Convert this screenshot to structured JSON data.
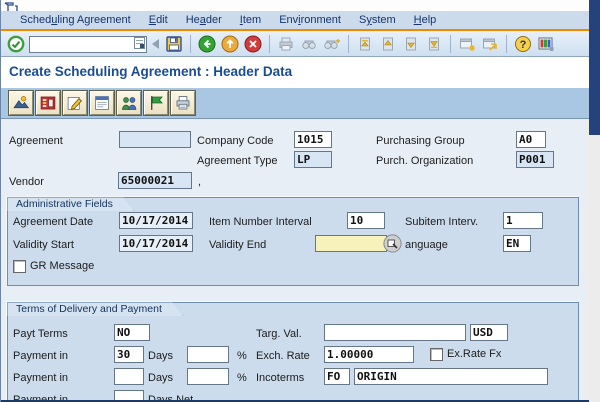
{
  "chrome": {
    "title": "Create Scheduling Agreement : Header Data",
    "menu": {
      "items": [
        {
          "pre": "Sched",
          "accel": "u",
          "post": "ling Agreement"
        },
        {
          "pre": "",
          "accel": "E",
          "post": "dit"
        },
        {
          "pre": "He",
          "accel": "a",
          "post": "der"
        },
        {
          "pre": "",
          "accel": "I",
          "post": "tem"
        },
        {
          "pre": "Env",
          "accel": "i",
          "post": "ronment"
        },
        {
          "pre": "S",
          "accel": "y",
          "post": "stem"
        },
        {
          "pre": "",
          "accel": "H",
          "post": "elp"
        }
      ]
    },
    "toolbar": {
      "command_value": "",
      "icons": [
        "enter",
        "command-field",
        "collapse",
        "save",
        "back",
        "exit",
        "cancel",
        "print",
        "find",
        "find-next",
        "first-page",
        "previous-page",
        "next-page",
        "last-page",
        "new-session",
        "create-shortcut",
        "help",
        "customize-layout"
      ]
    },
    "app_toolbar": {
      "buttons": [
        "overview",
        "item-detail",
        "change",
        "header-details",
        "partners",
        "set-flag",
        "print"
      ]
    }
  },
  "header_form": {
    "agreement": {
      "label": "Agreement",
      "value": ""
    },
    "company_code": {
      "label": "Company Code",
      "value": "1015"
    },
    "purchasing_group": {
      "label": "Purchasing Group",
      "value": "A0"
    },
    "agreement_type": {
      "label": "Agreement Type",
      "value": "LP"
    },
    "purch_organization": {
      "label": "Purch. Organization",
      "value": "P001"
    },
    "vendor": {
      "label": "Vendor",
      "value": "65000021",
      "suffix": ","
    }
  },
  "admin": {
    "section_title": "Administrative Fields",
    "agreement_date": {
      "label": "Agreement Date",
      "value": "10/17/2014"
    },
    "item_number_interval": {
      "label": "Item Number Interval",
      "value": "10"
    },
    "subitem_interval": {
      "label": "Subitem Interv.",
      "value": "1"
    },
    "validity_start": {
      "label": "Validity Start",
      "value": "10/17/2014"
    },
    "validity_end": {
      "label": "Validity End",
      "value": ""
    },
    "language": {
      "label": "anguage",
      "value": "EN"
    },
    "gr_message": {
      "label": "GR Message",
      "checked": false
    }
  },
  "terms": {
    "section_title": "Terms of Delivery and Payment",
    "payt_terms": {
      "label": "Payt Terms",
      "value": "NO"
    },
    "targ_val": {
      "label": "Targ. Val.",
      "value": "",
      "currency": "USD"
    },
    "exch_rate": {
      "label": "Exch. Rate",
      "value": "1.00000"
    },
    "ex_rate_fx": {
      "label": "Ex.Rate Fx",
      "checked": false
    },
    "incoterms": {
      "label": "Incoterms",
      "value1": "FO",
      "value2": "ORIGIN"
    },
    "payment_rows": [
      {
        "label": "Payment in",
        "days_value": "30",
        "days_label": "Days",
        "percent_value": "",
        "percent_label": "%"
      },
      {
        "label": "Payment in",
        "days_value": "",
        "days_label": "Days",
        "percent_value": "",
        "percent_label": "%"
      },
      {
        "label": "Payment in",
        "days_value": "",
        "days_label": "Days Net"
      }
    ]
  },
  "colors": {
    "accent_orange": "#ef8a00",
    "menubar_blue": "#ccdbeb",
    "app_toolbar_blue": "#a9c6e3",
    "content_blue": "#cddcec",
    "title_text": "#1a4c96",
    "readonly_field": "#d7e5f4",
    "focused_field": "#f7f2bb",
    "window_edge_navy": "#26427c",
    "enter_green": "#36a336",
    "exit_amber": "#eda93c",
    "cancel_red": "#cf3d3d"
  }
}
